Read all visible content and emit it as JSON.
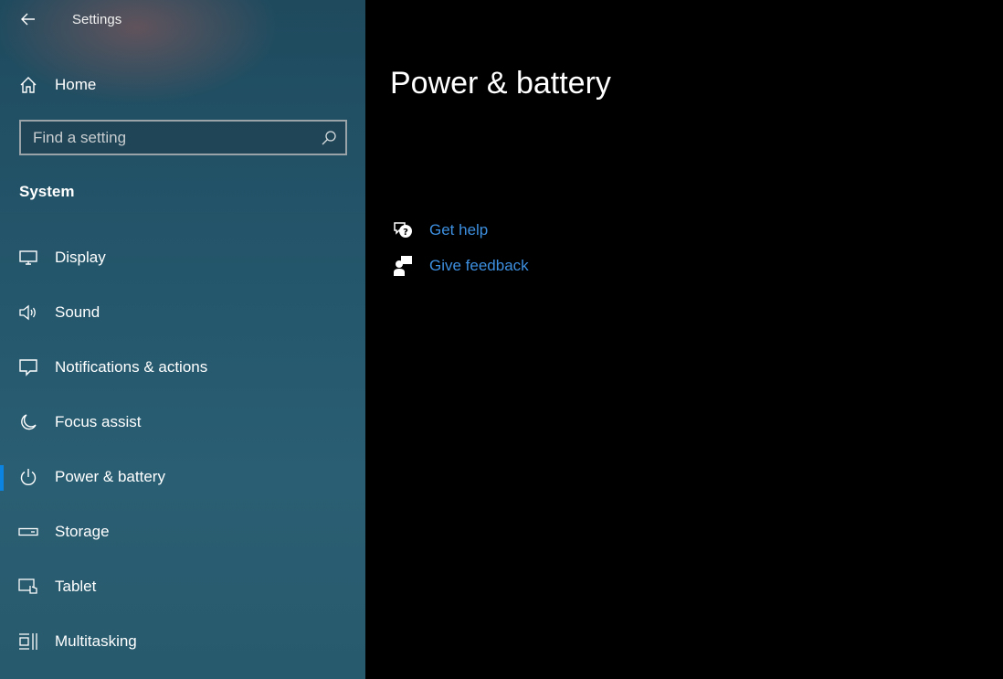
{
  "window": {
    "title": "Settings"
  },
  "sidebar": {
    "home_label": "Home",
    "search_placeholder": "Find a setting",
    "section_heading": "System",
    "items": [
      {
        "label": "Display",
        "icon": "monitor-icon",
        "selected": false
      },
      {
        "label": "Sound",
        "icon": "speaker-icon",
        "selected": false
      },
      {
        "label": "Notifications & actions",
        "icon": "notification-icon",
        "selected": false
      },
      {
        "label": "Focus assist",
        "icon": "moon-icon",
        "selected": false
      },
      {
        "label": "Power & battery",
        "icon": "power-icon",
        "selected": true
      },
      {
        "label": "Storage",
        "icon": "storage-icon",
        "selected": false
      },
      {
        "label": "Tablet",
        "icon": "tablet-icon",
        "selected": false
      },
      {
        "label": "Multitasking",
        "icon": "multitasking-icon",
        "selected": false
      }
    ]
  },
  "main": {
    "page_title": "Power & battery",
    "links": {
      "get_help": "Get help",
      "give_feedback": "Give feedback"
    }
  },
  "colors": {
    "accent": "#0a84e0",
    "link": "#3d8fe0",
    "content_background": "#000000",
    "sidebar_background": "#24566b"
  }
}
